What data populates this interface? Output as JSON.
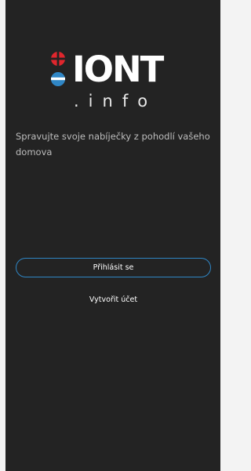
{
  "brand": {
    "name": "IONT",
    "domain": ".info"
  },
  "welcome": {
    "tagline": "Spravujte svoje nabíječky z pohodlí vašeho domova"
  },
  "actions": {
    "login_label": "Přihlásit se",
    "create_account_label": "Vytvořit účet"
  },
  "colors": {
    "background": "#232323",
    "accent_blue": "#2f86c5",
    "accent_red": "#e0262d",
    "text_primary": "#ffffff",
    "text_secondary": "#bdbdbd"
  },
  "icons": {
    "logo_mark": "iont-logo-icon"
  }
}
